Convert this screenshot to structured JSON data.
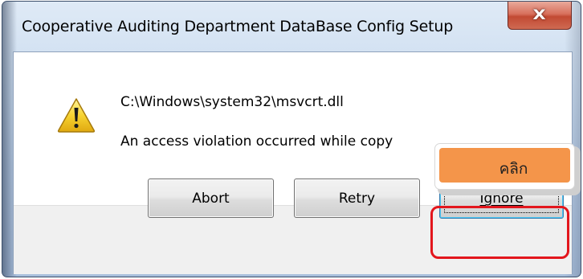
{
  "window": {
    "title": "Cooperative Auditing Department DataBase Config Setup",
    "close_label": "X"
  },
  "message": {
    "path": "C:\\Windows\\system32\\msvcrt.dll",
    "body": "An access violation occurred while copy"
  },
  "buttons": {
    "abort": "Abort",
    "retry": "Retry",
    "ignore": "Ignore"
  },
  "annotation": {
    "callout_text": "คลิก",
    "callout_color": "#f4954a",
    "highlight_color": "#e3161d"
  },
  "icons": {
    "warning": "warning-icon"
  }
}
